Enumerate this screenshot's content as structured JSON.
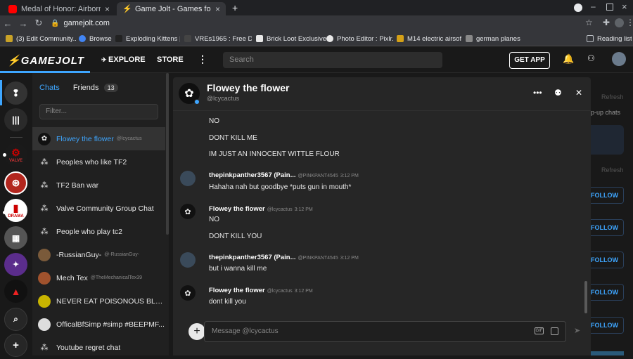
{
  "browser": {
    "tabs": [
      {
        "title": "Medal of Honor: Airborne. Full c",
        "close": "×"
      },
      {
        "title": "Game Jolt - Games for the love o",
        "close": "×"
      }
    ],
    "new_tab": "+",
    "url": "gamejolt.com",
    "bookmarks": [
      "(3) Edit Community...",
      "Browse",
      "Exploding Kittens |...",
      "VREs1965 : Free Do...",
      "Brick Loot Exclusive...",
      "Photo Editor : Pixlr...",
      "M14 electric airsoft...",
      "german planes"
    ],
    "reading_list": "Reading list"
  },
  "header": {
    "logo": "GAMEJOLT",
    "explore": "EXPLORE",
    "store": "STORE",
    "search_placeholder": "Search",
    "get_app": "GET APP"
  },
  "rail": {
    "valve_label": "VALVE",
    "drama_label": "DRAMA"
  },
  "chatlist": {
    "tab_chats": "Chats",
    "tab_friends": "Friends",
    "friends_count": "13",
    "filter_placeholder": "Filter...",
    "items": [
      {
        "name": "Flowey the flower",
        "handle": "@lcycactus",
        "selected": true
      },
      {
        "name": "Peoples who like TF2",
        "handle": ""
      },
      {
        "name": "TF2 Ban war",
        "handle": ""
      },
      {
        "name": "Valve Community Group Chat",
        "handle": ""
      },
      {
        "name": "People who play tc2",
        "handle": ""
      },
      {
        "name": "-RussianGuy-",
        "handle": "@-RussianGuy-"
      },
      {
        "name": "Mech Tex",
        "handle": "@TheMechanicalTex39"
      },
      {
        "name": "NEVER EAT POISONOUS BLO...",
        "handle": ""
      },
      {
        "name": "OfficalBfSimp #simp #BEEPMF...",
        "handle": ""
      },
      {
        "name": "Youtube regret chat",
        "handle": ""
      }
    ]
  },
  "conversation": {
    "name": "Flowey the flower",
    "handle": "@lcycactus",
    "top_lines": [
      "NO",
      "DONT KILL ME",
      "IM JUST AN INNOCENT WITTLE FLOUR"
    ],
    "messages": [
      {
        "author": "thepinkpanther3567 (Pain...",
        "handle": "@PINKPANT4545",
        "time": "3:12 PM",
        "lines": [
          "Hahaha nah but goodbye *puts gun in mouth*"
        ]
      },
      {
        "author": "Flowey the flower",
        "handle": "@lcycactus",
        "time": "3:12 PM",
        "lines": [
          "NO",
          "DONT KILL YOU"
        ]
      },
      {
        "author": "thepinkpanther3567 (Pain...",
        "handle": "@PINKPANT4545",
        "time": "3:12 PM",
        "lines": [
          "but i wanna kill me"
        ]
      },
      {
        "author": "Flowey the flower",
        "handle": "@lcycactus",
        "time": "3:12 PM",
        "lines": [
          "dont kill you"
        ]
      }
    ],
    "composer_placeholder": "Message @lcycactus"
  },
  "rightpanel": {
    "refresh": "Refresh",
    "popup": "p-up chats",
    "refresh2": "Refresh",
    "follow": "FOLLOW"
  },
  "colors": {
    "accent": "#3ea6ff",
    "gj_green": "#ccff00",
    "bg": "#191919"
  }
}
